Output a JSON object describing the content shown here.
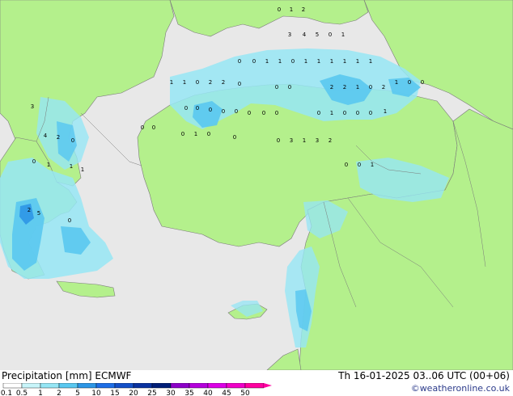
{
  "title": "Precipitation [mm] ECMWF",
  "timestamp": "Th 16-01-2025 03..06 UTC (00+06)",
  "credit": "©weatheronline.co.uk",
  "colors": {
    "sea": "#e8e8e8",
    "land": "#b4f08c",
    "border": "#7a7a7a",
    "rain_light": "#96e6f5",
    "rain_mid": "#5ac8f0",
    "rain_heavy": "#2d96e6"
  },
  "legend": {
    "labels": [
      "0.1",
      "0.5",
      "1",
      "2",
      "5",
      "10",
      "15",
      "20",
      "25",
      "30",
      "35",
      "40",
      "45",
      "50"
    ],
    "colors": [
      "#ffffff",
      "#c8f5fa",
      "#96e6f5",
      "#5ac8f0",
      "#2d96e6",
      "#1e6ee6",
      "#1450c8",
      "#0a32a0",
      "#001e78",
      "#8c00c8",
      "#b400dc",
      "#dc00e6",
      "#f000c8",
      "#ff00a0"
    ]
  },
  "map_labels": [
    "0",
    "1",
    "2",
    "3",
    "4",
    "5",
    "0",
    "1",
    "0",
    "0",
    "1",
    "1",
    "0",
    "1",
    "1",
    "1",
    "1",
    "1",
    "1",
    "2",
    "2",
    "1",
    "0",
    "2",
    "1",
    "0",
    "0",
    "1",
    "1",
    "0",
    "2",
    "2",
    "0",
    "0",
    "0",
    "0",
    "0",
    "0",
    "0",
    "0",
    "0",
    "0",
    "0",
    "0",
    "1",
    "0",
    "0",
    "0",
    "1",
    "0",
    "0",
    "0",
    "1",
    "0",
    "0",
    "0",
    "3",
    "1",
    "3",
    "2",
    "0",
    "0",
    "1",
    "3",
    "4",
    "2",
    "0",
    "0",
    "1",
    "1",
    "1",
    "2",
    "5",
    "0"
  ]
}
